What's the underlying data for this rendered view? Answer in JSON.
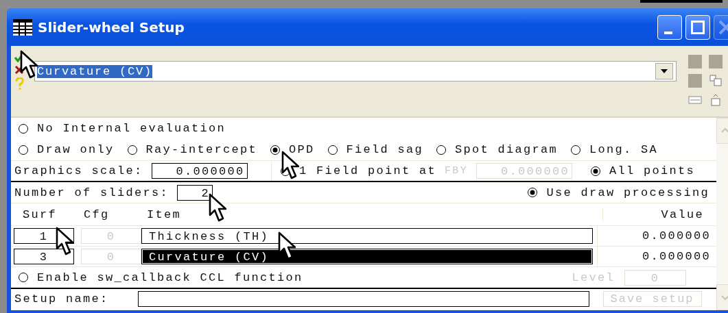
{
  "window": {
    "title": "Slider-wheel Setup",
    "controls": [
      {
        "kind": "minimize",
        "disabled": false
      },
      {
        "kind": "maximize",
        "disabled": false
      },
      {
        "kind": "close",
        "disabled": true
      }
    ]
  },
  "toolbar": {
    "combo_value": "Curvature (CV)",
    "combo_selected": true
  },
  "evaluation_rows": [
    [
      {
        "label": "No Internal evaluation",
        "selected": false
      }
    ],
    [
      {
        "label": "Draw only",
        "selected": false
      },
      {
        "label": "Ray-intercept",
        "selected": false
      },
      {
        "label": "OPD",
        "selected": true
      },
      {
        "label": "Field sag",
        "selected": false
      },
      {
        "label": "Spot diagram",
        "selected": false
      },
      {
        "label": "Long. SA",
        "selected": false
      }
    ]
  ],
  "graphics_scale": {
    "label": "Graphics scale:",
    "value": "0.000000"
  },
  "field_point": {
    "option": {
      "label": "1 Field point at",
      "selected": false
    },
    "coord_label": "FBY",
    "coord_value": "0.000000",
    "disabled": true,
    "all_points": {
      "label": "All points",
      "selected": true
    }
  },
  "sliders": {
    "label": "Number of sliders:",
    "value": "2",
    "draw_processing": {
      "label": "Use draw processing",
      "checked": true
    }
  },
  "table": {
    "columns": [
      "Surf",
      "Cfg",
      "Item",
      "Value"
    ],
    "rows": [
      {
        "surf": "1",
        "cfg": "0",
        "cfg_disabled": true,
        "item": "Thickness (TH)",
        "selected": false,
        "value": "0.000000"
      },
      {
        "surf": "3",
        "cfg": "0",
        "cfg_disabled": true,
        "item": "Curvature (CV)",
        "selected": true,
        "value": "0.000000"
      }
    ]
  },
  "callback": {
    "label": "Enable sw_callback CCL function",
    "checked": false,
    "level_label": "Level",
    "level_value": "0",
    "disabled": true
  },
  "setup": {
    "label": "Setup name:",
    "button": "Save setup",
    "button_disabled": true
  }
}
